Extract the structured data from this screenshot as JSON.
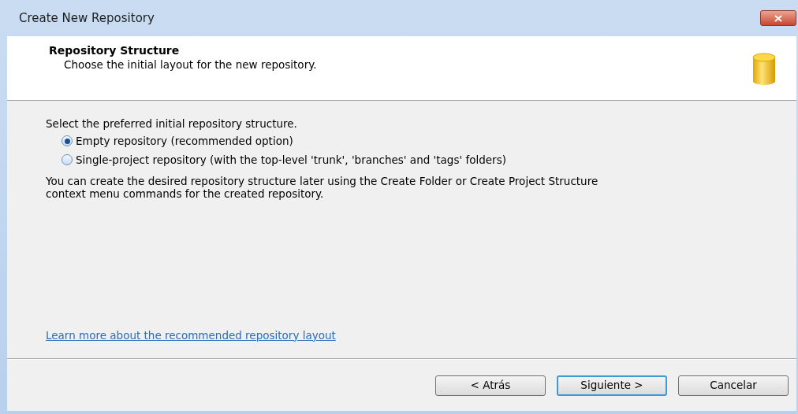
{
  "window": {
    "title": "Create New Repository"
  },
  "header": {
    "title": "Repository Structure",
    "subtitle": "Choose the initial layout for the new repository."
  },
  "body": {
    "prompt": "Select the preferred initial repository structure.",
    "options": [
      {
        "label": "Empty repository (recommended option)",
        "selected": true
      },
      {
        "label": "Single-project repository (with the top-level 'trunk', 'branches' and 'tags' folders)",
        "selected": false
      }
    ],
    "note": "You can create the desired repository structure later using the Create Folder or Create Project Structure context menu commands for the created repository.",
    "link": "Learn more about the recommended repository layout"
  },
  "buttons": [
    {
      "label": "< Atrás",
      "default": false
    },
    {
      "label": "Siguiente >",
      "default": true
    },
    {
      "label": "Cancelar",
      "default": false
    }
  ]
}
